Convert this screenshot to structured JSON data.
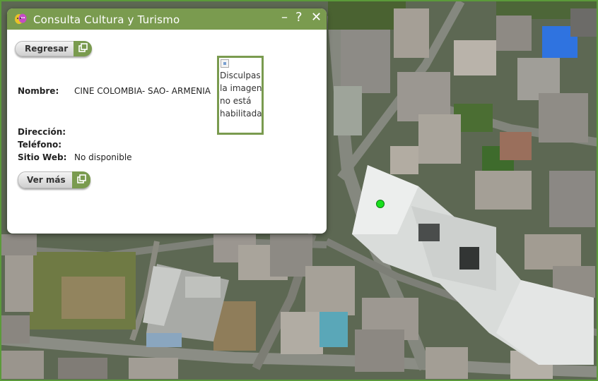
{
  "panel": {
    "title": "Consulta Cultura y Turismo",
    "minimize_label": "–",
    "help_label": "?",
    "close_label": "✕",
    "back_button_label": "Regresar",
    "more_button_label": "Ver más",
    "fields": [
      {
        "label": "Nombre:",
        "value": "CINE COLOMBIA- SAO- ARMENIA"
      },
      {
        "label": "Dirección:",
        "value": ""
      },
      {
        "label": "Teléfono:",
        "value": ""
      },
      {
        "label": "Sitio Web:",
        "value": "No disponible"
      }
    ],
    "image_alt": "Disculpas la imagen no está habilitada"
  },
  "map": {
    "type": "satellite imagery",
    "marker_color": "#19e01e",
    "accent_color": "#7a9b4f"
  }
}
